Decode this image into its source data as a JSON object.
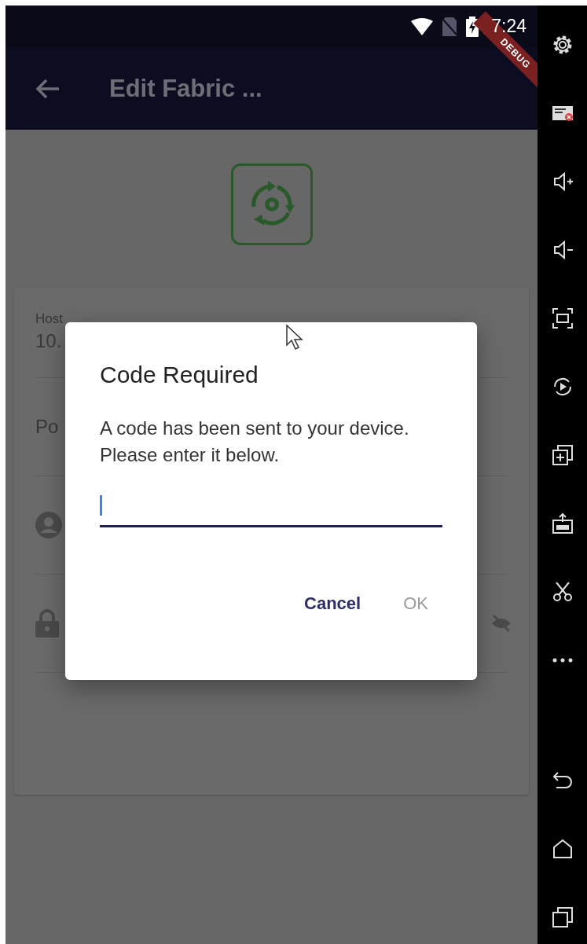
{
  "status_bar": {
    "time": "7:24",
    "debug_banner": "DEBUG"
  },
  "app_bar": {
    "title": "Edit Fabric ..."
  },
  "form": {
    "fields": [
      {
        "kind": "text",
        "label": "Host",
        "value": "10."
      },
      {
        "kind": "text",
        "label": "Po"
      },
      {
        "kind": "user"
      },
      {
        "kind": "password"
      }
    ]
  },
  "dialog": {
    "title": "Code Required",
    "message": "A code has been sent to your device. Please enter it below.",
    "buttons": [
      {
        "label": "Cancel",
        "disabled": false
      },
      {
        "label": "OK",
        "disabled": true
      }
    ]
  }
}
